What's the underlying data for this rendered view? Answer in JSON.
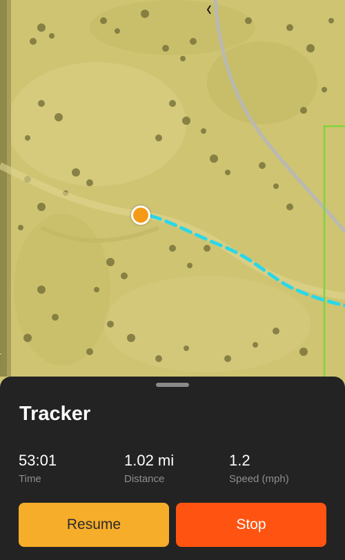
{
  "map": {
    "attribution": "box",
    "route_color": "#2ad8e8",
    "location_color": "#f59a16"
  },
  "tracker": {
    "title": "Tracker",
    "stats": [
      {
        "value": "53:01",
        "label": "Time"
      },
      {
        "value": "1.02 mi",
        "label": "Distance"
      },
      {
        "value": "1.2",
        "label": "Speed (mph)"
      }
    ],
    "resume_label": "Resume",
    "stop_label": "Stop",
    "resume_color": "#f6ad2a",
    "stop_color": "#ff5411"
  }
}
